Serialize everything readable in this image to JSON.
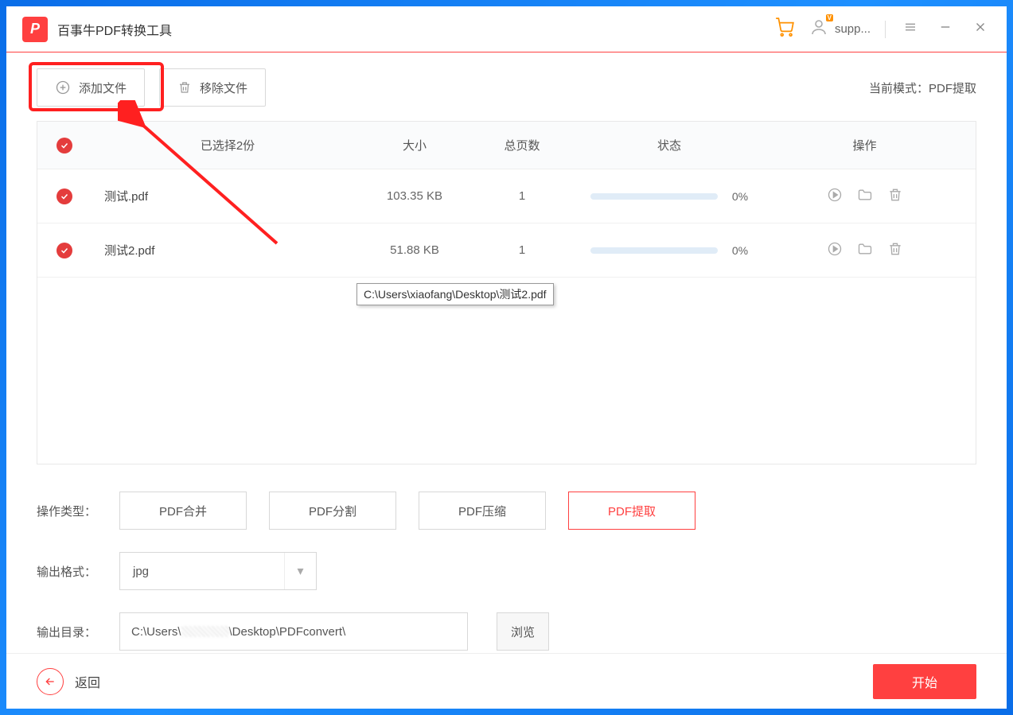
{
  "app": {
    "logo_glyph": "P",
    "title": "百事牛PDF转换工具",
    "user_name": "supp...",
    "vip_badge": "V"
  },
  "toolbar": {
    "add_file": "添加文件",
    "remove_file": "移除文件",
    "mode_prefix": "当前模式：",
    "mode_value": "PDF提取"
  },
  "table": {
    "header": {
      "selected": "已选择2份",
      "size": "大小",
      "pages": "总页数",
      "status": "状态",
      "ops": "操作"
    },
    "rows": [
      {
        "name": "测试.pdf",
        "size": "103.35 KB",
        "pages": "1",
        "pct": "0%"
      },
      {
        "name": "测试2.pdf",
        "size": "51.88 KB",
        "pages": "1",
        "pct": "0%"
      }
    ],
    "tooltip": "C:\\Users\\xiaofang\\Desktop\\测试2.pdf"
  },
  "settings": {
    "op_type_label": "操作类型：",
    "op_types": [
      "PDF合并",
      "PDF分割",
      "PDF压缩",
      "PDF提取"
    ],
    "active_op_index": 3,
    "format_label": "输出格式：",
    "format_value": "jpg",
    "outdir_label": "输出目录：",
    "outdir_prefix": "C:\\Users\\",
    "outdir_suffix": "\\Desktop\\PDFconvert\\",
    "browse": "浏览"
  },
  "footer": {
    "back": "返回",
    "start": "开始"
  }
}
